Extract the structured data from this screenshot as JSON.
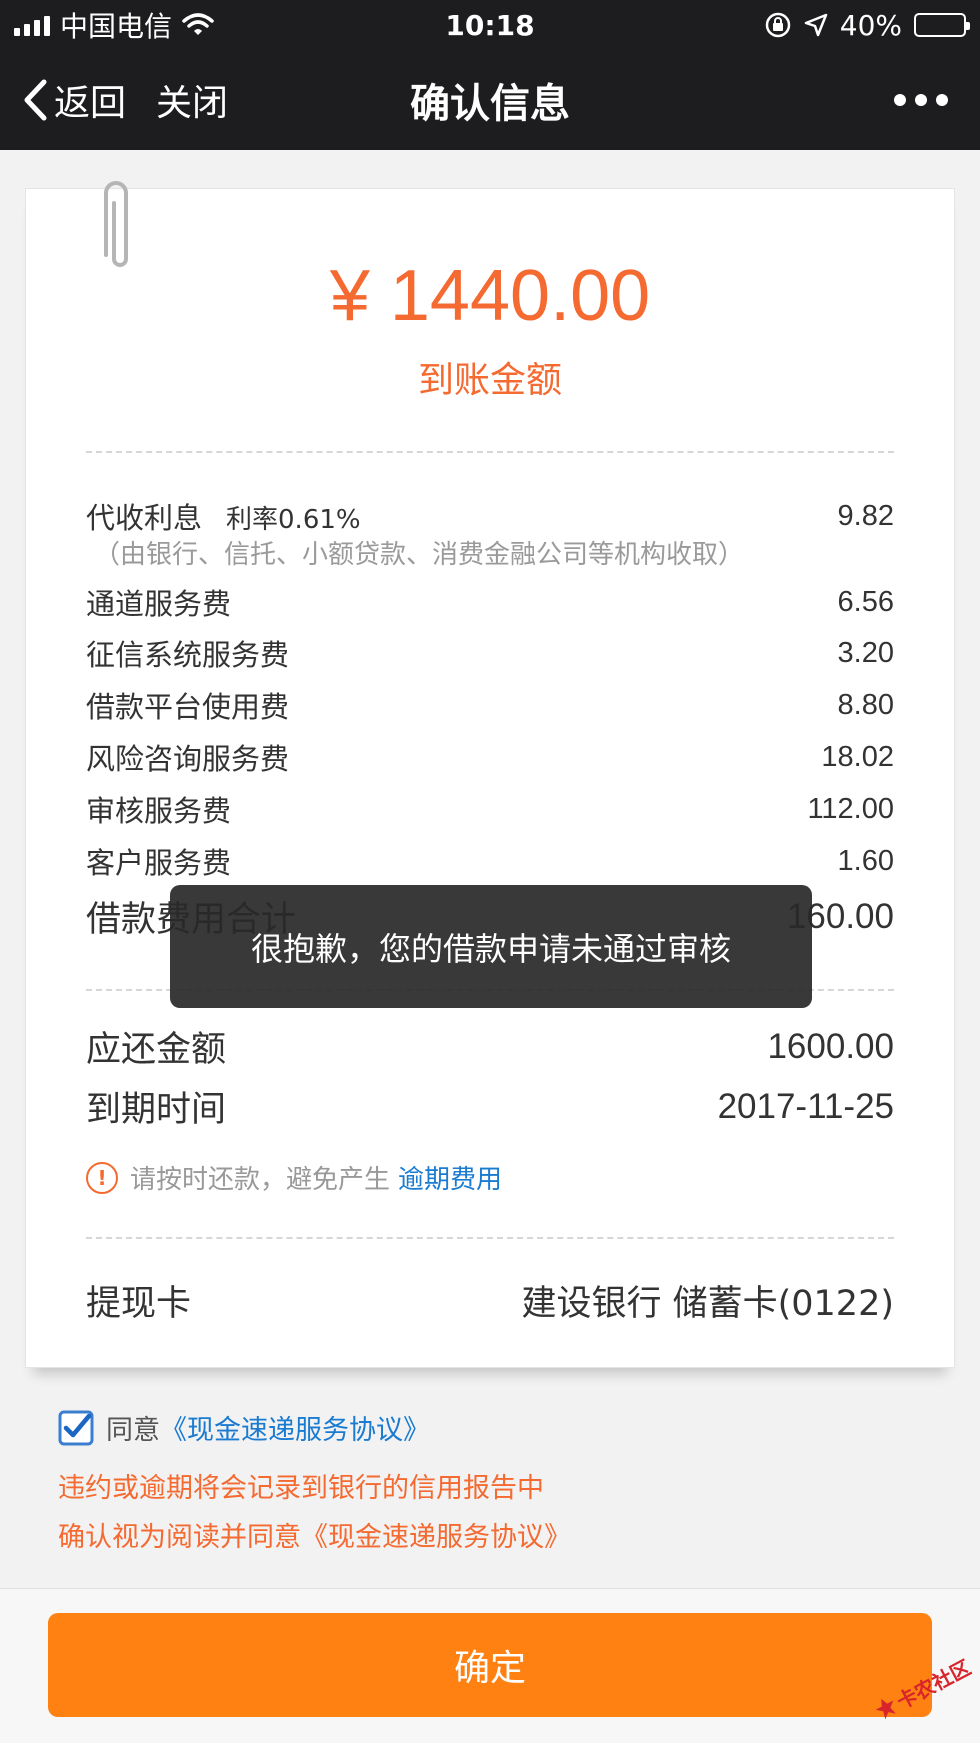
{
  "status_bar": {
    "carrier": "中国电信",
    "time": "10:18",
    "battery_percent": "40%",
    "battery_level": 0.4,
    "icons": [
      "signal-icon",
      "wifi-icon",
      "rotation-lock-icon",
      "location-arrow-icon",
      "battery-icon"
    ]
  },
  "nav": {
    "back_label": "返回",
    "close_label": "关闭",
    "title": "确认信息",
    "icons": [
      "chevron-left-icon",
      "more-icon"
    ]
  },
  "receipt": {
    "amount": "¥ 1440.00",
    "amount_label": "到账金额",
    "fees": [
      {
        "label": "代收利息",
        "value": "9.82"
      },
      {
        "label": "通道服务费",
        "value": "6.56"
      },
      {
        "label": "征信系统服务费",
        "value": "3.20"
      },
      {
        "label": "借款平台使用费",
        "value": "8.80"
      },
      {
        "label": "风险咨询服务费",
        "value": "18.02"
      },
      {
        "label": "审核服务费",
        "value": "112.00"
      },
      {
        "label": "客户服务费",
        "value": "1.60"
      }
    ],
    "interest_rate": "利率0.61%",
    "interest_note": "（由银行、信托、小额贷款、消费金融公司等机构收取）",
    "total_label": "借款费用合计",
    "total_value": "160.00",
    "repay_label": "应还金额",
    "repay_value": "1600.00",
    "due_label": "到期时间",
    "due_value": "2017-11-25",
    "reminder_text": "请按时还款，避免产生",
    "reminder_link": "逾期费用",
    "warning_icon_glyph": "!",
    "card_label": "提现卡",
    "card_value": "建设银行 储蓄卡(0122)"
  },
  "agreement": {
    "prefix": "同意",
    "link": "《现金速递服务协议》",
    "checked": true,
    "notice_lines": [
      "违约或逾期将会记录到银行的信用报告中",
      "确认视为阅读并同意《现金速递服务协议》"
    ]
  },
  "confirm_label": "确定",
  "toast": "很抱歉，您的借款申请未通过审核",
  "watermark": "卡农社区",
  "colors": {
    "accent_orange": "#f46a31",
    "button_orange": "#ff8112",
    "link_blue": "#1a7bd1",
    "nav_background": "#1d1d1f"
  }
}
